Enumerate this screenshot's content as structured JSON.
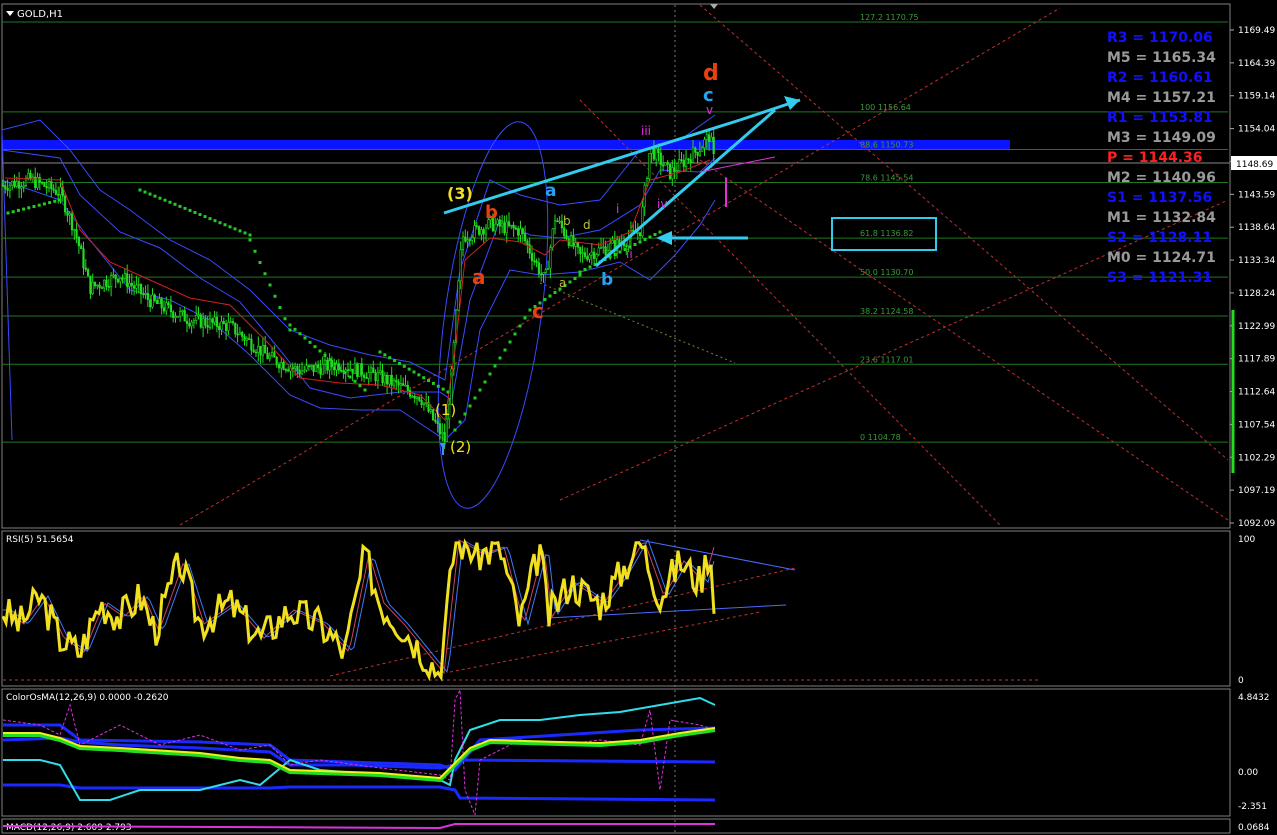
{
  "window": {
    "title": "GOLD,H1"
  },
  "price_axis": {
    "ticks": [
      "1169.49",
      "1164.39",
      "1159.14",
      "1154.04",
      "1148.69",
      "1143.59",
      "1138.64",
      "1133.34",
      "1128.24",
      "1122.99",
      "1117.89",
      "1112.64",
      "1107.54",
      "1102.29",
      "1097.19",
      "1092.09"
    ],
    "current_price": "1148.69"
  },
  "pivots": [
    {
      "label": "R3 = 1170.06",
      "color": "#1010ff"
    },
    {
      "label": "M5 = 1165.34",
      "color": "#9a9a9a"
    },
    {
      "label": "R2 = 1160.61",
      "color": "#1010ff"
    },
    {
      "label": "M4 = 1157.21",
      "color": "#9a9a9a"
    },
    {
      "label": "R1 = 1153.81",
      "color": "#1010ff"
    },
    {
      "label": "M3 = 1149.09",
      "color": "#9a9a9a"
    },
    {
      "label": "P  = 1144.36",
      "color": "#ff2020"
    },
    {
      "label": "M2 = 1140.96",
      "color": "#9a9a9a"
    },
    {
      "label": "S1 = 1137.56",
      "color": "#1010ff"
    },
    {
      "label": "M1 = 1132.84",
      "color": "#9a9a9a"
    },
    {
      "label": "S2 = 1128.11",
      "color": "#1010ff"
    },
    {
      "label": "M0 = 1124.71",
      "color": "#9a9a9a"
    },
    {
      "label": "S3 = 1121.31",
      "color": "#1010ff"
    }
  ],
  "fib_levels": [
    {
      "label": "127.2 1170.75",
      "price": 1170.75
    },
    {
      "label": "100 1156.64",
      "price": 1156.64
    },
    {
      "label": "88.6 1150.73",
      "price": 1150.73
    },
    {
      "label": "78.6 1145.54",
      "price": 1145.54
    },
    {
      "label": "61.8 1136.82",
      "price": 1136.82
    },
    {
      "label": "50.0 1130.70",
      "price": 1130.7
    },
    {
      "label": "38.2 1124.58",
      "price": 1124.58
    },
    {
      "label": "23.6 1117.01",
      "price": 1117.01
    },
    {
      "label": "0 1104.78",
      "price": 1104.78
    }
  ],
  "wave_labels": {
    "w3": "(3)",
    "w1": "(1)",
    "w2": "(2)",
    "a_red": "a",
    "b_red": "b",
    "c_red": "c",
    "d_red": "d",
    "a_blue": "a",
    "b_blue": "b",
    "c_blue": "c",
    "sub_b": "b",
    "sub_d": "d",
    "sub_a": "a",
    "i": "i",
    "ii": "ii",
    "iii": "iii",
    "iv": "iv",
    "v": "v"
  },
  "rsi": {
    "title": "RSI(5) 51.5654",
    "max": "100",
    "min": "0"
  },
  "osma": {
    "title": "ColorOsMA(12,26,9) 0.0000 -0.2620",
    "top": "4.8432",
    "mid": "0.00",
    "bottom": "-2.351"
  },
  "macd": {
    "title": "MACD(12,26,9) 2.609 2.793",
    "right": "0.0684"
  },
  "colors": {
    "bollinger": "#3a4aff",
    "psar": "#22cc22",
    "trend": "#33ccee",
    "fib": "#1f7a1f",
    "pivot_band": "#0a14ff"
  },
  "chart_data": {
    "type": "candlestick",
    "title": "GOLD,H1",
    "y_range": [
      1092.09,
      1172
    ],
    "approx_close_path": [
      [
        0,
        1145
      ],
      [
        30,
        1146
      ],
      [
        60,
        1144
      ],
      [
        75,
        1138
      ],
      [
        90,
        1129
      ],
      [
        120,
        1131
      ],
      [
        150,
        1127
      ],
      [
        190,
        1124
      ],
      [
        230,
        1123
      ],
      [
        270,
        1118
      ],
      [
        300,
        1116
      ],
      [
        340,
        1117
      ],
      [
        380,
        1115
      ],
      [
        420,
        1112
      ],
      [
        445,
        1105
      ],
      [
        452,
        1116
      ],
      [
        462,
        1137
      ],
      [
        490,
        1139
      ],
      [
        520,
        1138
      ],
      [
        545,
        1130
      ],
      [
        555,
        1140
      ],
      [
        580,
        1134
      ],
      [
        620,
        1136
      ],
      [
        640,
        1138
      ],
      [
        650,
        1151
      ],
      [
        670,
        1147
      ],
      [
        700,
        1151
      ],
      [
        710,
        1153
      ],
      [
        715,
        1148
      ]
    ]
  }
}
